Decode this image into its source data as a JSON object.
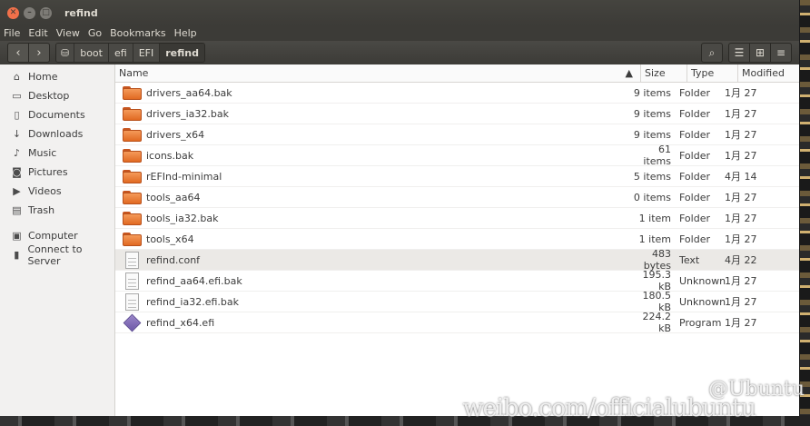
{
  "window": {
    "title": "refind"
  },
  "menubar": [
    "File",
    "Edit",
    "View",
    "Go",
    "Bookmarks",
    "Help"
  ],
  "breadcrumbs": [
    "boot",
    "efi",
    "EFI",
    "refind"
  ],
  "sidebar": {
    "places": [
      {
        "label": "Home",
        "icon": "home-icon"
      },
      {
        "label": "Desktop",
        "icon": "desktop-icon"
      },
      {
        "label": "Documents",
        "icon": "documents-icon"
      },
      {
        "label": "Downloads",
        "icon": "downloads-icon"
      },
      {
        "label": "Music",
        "icon": "music-icon"
      },
      {
        "label": "Pictures",
        "icon": "pictures-icon"
      },
      {
        "label": "Videos",
        "icon": "videos-icon"
      },
      {
        "label": "Trash",
        "icon": "trash-icon"
      }
    ],
    "devices": [
      {
        "label": "Computer",
        "icon": "computer-icon"
      },
      {
        "label": "Connect to Server",
        "icon": "server-icon"
      }
    ]
  },
  "columns": {
    "name": "Name",
    "size": "Size",
    "type": "Type",
    "modified": "Modified"
  },
  "files": [
    {
      "name": "drivers_aa64.bak",
      "size": "9 items",
      "type": "Folder",
      "modified": "1月 27",
      "kind": "folder"
    },
    {
      "name": "drivers_ia32.bak",
      "size": "9 items",
      "type": "Folder",
      "modified": "1月 27",
      "kind": "folder"
    },
    {
      "name": "drivers_x64",
      "size": "9 items",
      "type": "Folder",
      "modified": "1月 27",
      "kind": "folder"
    },
    {
      "name": "icons.bak",
      "size": "61 items",
      "type": "Folder",
      "modified": "1月 27",
      "kind": "folder"
    },
    {
      "name": "rEFInd-minimal",
      "size": "5 items",
      "type": "Folder",
      "modified": "4月 14",
      "kind": "folder"
    },
    {
      "name": "tools_aa64",
      "size": "0 items",
      "type": "Folder",
      "modified": "1月 27",
      "kind": "folder"
    },
    {
      "name": "tools_ia32.bak",
      "size": "1 item",
      "type": "Folder",
      "modified": "1月 27",
      "kind": "folder"
    },
    {
      "name": "tools_x64",
      "size": "1 item",
      "type": "Folder",
      "modified": "1月 27",
      "kind": "folder"
    },
    {
      "name": "refind.conf",
      "size": "483 bytes",
      "type": "Text",
      "modified": "4月 22",
      "kind": "text",
      "selected": true
    },
    {
      "name": "refind_aa64.efi.bak",
      "size": "195.3 kB",
      "type": "Unknown",
      "modified": "1月 27",
      "kind": "text"
    },
    {
      "name": "refind_ia32.efi.bak",
      "size": "180.5 kB",
      "type": "Unknown",
      "modified": "1月 27",
      "kind": "text"
    },
    {
      "name": "refind_x64.efi",
      "size": "224.2 kB",
      "type": "Program",
      "modified": "1月 27",
      "kind": "program"
    }
  ],
  "watermark": {
    "line1": "@Ubuntu",
    "line2": "weibo.com/officialubuntu"
  }
}
